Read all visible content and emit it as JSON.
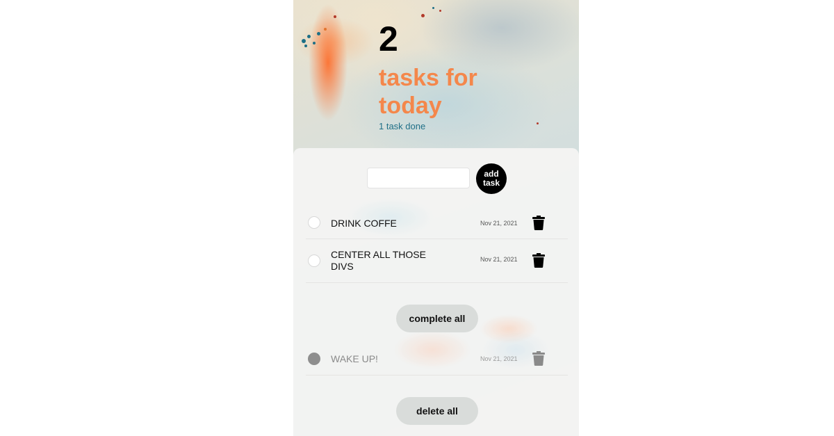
{
  "header": {
    "count": "2",
    "subtitle": "tasks for today",
    "done_text": "1 task done"
  },
  "add_form": {
    "input_value": "",
    "input_placeholder": "",
    "button_label": "add task"
  },
  "tasks": [
    {
      "text": "DRINK COFFE",
      "date": "Nov 21, 2021",
      "completed": false
    },
    {
      "text": "CENTER ALL THOSE DIVS",
      "date": "Nov 21, 2021",
      "completed": false
    }
  ],
  "actions": {
    "complete_all_label": "complete all",
    "delete_all_label": "delete all"
  },
  "completed_tasks": [
    {
      "text": "WAKE UP!",
      "date": "Nov 21, 2021",
      "completed": true
    }
  ],
  "icons": {
    "delete": "trash-icon",
    "checkbox": "circle-checkbox-icon"
  },
  "colors": {
    "accent": "#f4874b",
    "done_text": "#1f6f87",
    "button_dark": "#000000",
    "button_light": "#d9dcda",
    "completed_check": "#8e8e8e"
  }
}
